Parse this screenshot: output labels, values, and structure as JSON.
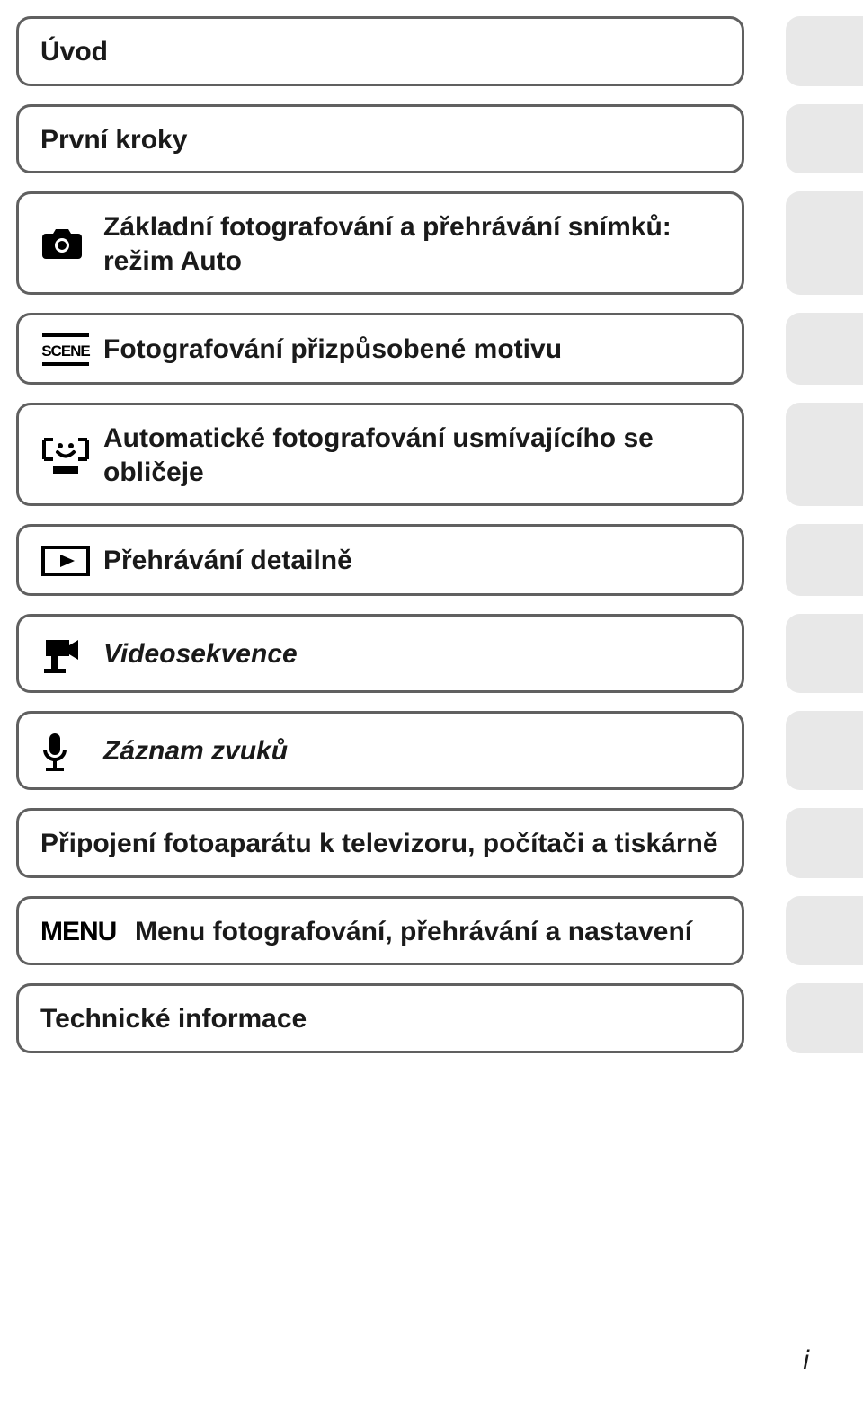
{
  "page_number": "i",
  "items": [
    {
      "label": "Úvod",
      "italic": false
    },
    {
      "label": "První kroky",
      "italic": false
    },
    {
      "label": "Základní fotografování a přehrávání snímků: režim Auto",
      "italic": false
    },
    {
      "label": "Fotografování přizpůsobené motivu",
      "italic": false
    },
    {
      "label": "Automatické fotografování usmívajícího se obličeje",
      "italic": false
    },
    {
      "label": "Přehrávání detailně",
      "italic": false
    },
    {
      "label": "Videosekvence",
      "italic": true
    },
    {
      "label": "Záznam zvuků",
      "italic": true
    },
    {
      "label": "Připojení fotoaparátu k televizoru, počítači a tiskárně",
      "italic": false
    },
    {
      "label": "Menu fotografování, přehrávání a nastavení",
      "italic": false
    },
    {
      "label": "Technické informace",
      "italic": false
    }
  ],
  "icons": {
    "camera": "camera-icon",
    "scene": "SCENE",
    "smile": "smile-bracket-icon",
    "play": "play-icon",
    "video": "video-camera-icon",
    "mic": "microphone-icon",
    "menu": "MENU"
  }
}
